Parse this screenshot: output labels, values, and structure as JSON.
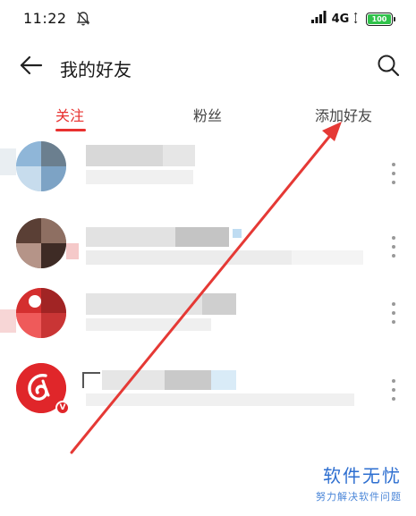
{
  "status_bar": {
    "time": "11:22",
    "network": "4G",
    "battery": "100",
    "icons": [
      "mute-bell-icon",
      "signal-icon",
      "battery-icon"
    ]
  },
  "header": {
    "title": "我的好友",
    "icons": [
      "back-arrow-icon",
      "search-icon"
    ]
  },
  "tabs": [
    {
      "label": "关注",
      "active": true
    },
    {
      "label": "粉丝",
      "active": false
    },
    {
      "label": "添加好友",
      "active": false
    }
  ],
  "friends": [
    {
      "name": "",
      "subtitle": ""
    },
    {
      "name": "",
      "subtitle": ""
    },
    {
      "name": "",
      "subtitle": ""
    },
    {
      "name": "",
      "subtitle": ""
    }
  ],
  "colors": {
    "accent": "#e8312f",
    "annotation_arrow": "#e53935",
    "watermark": "#2e6fd0"
  },
  "watermark": {
    "title": "软件无忧",
    "subtitle": "努力解决软件问题"
  }
}
